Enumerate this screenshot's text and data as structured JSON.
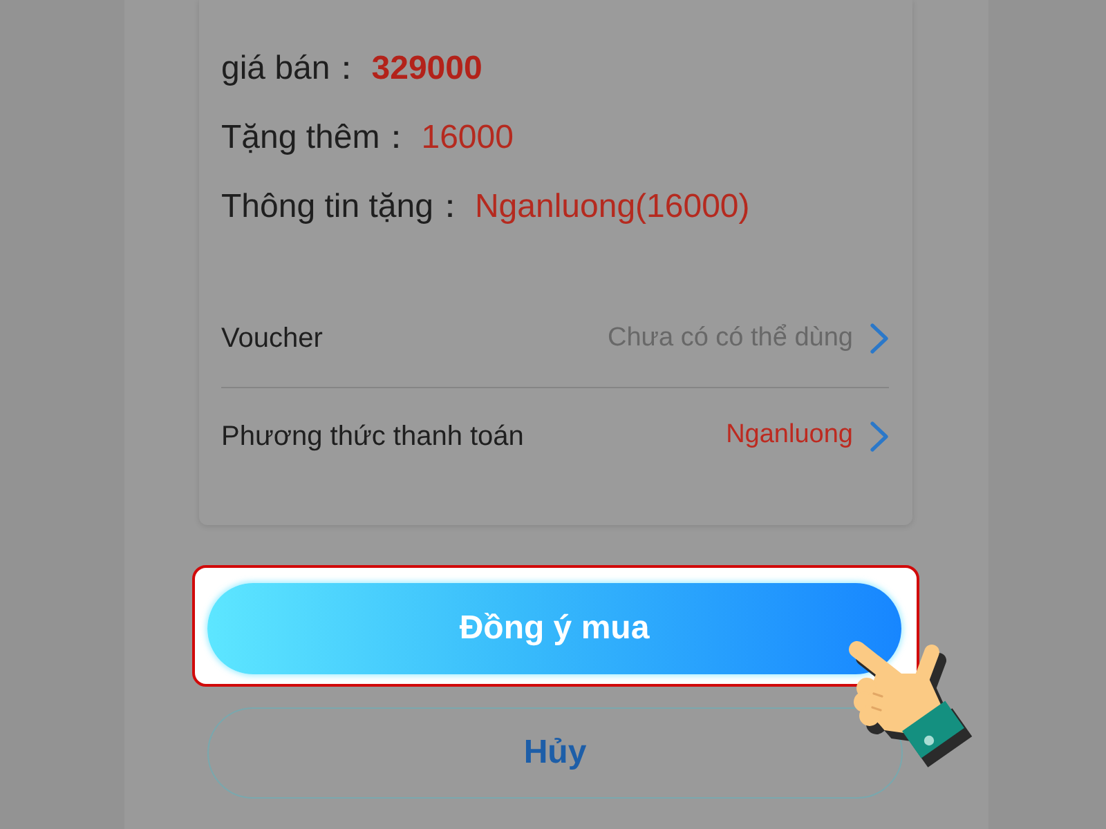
{
  "details": [
    {
      "label": "giá bán：",
      "value": "329000",
      "kind": "price"
    },
    {
      "label": "Tặng thêm：",
      "value": "16000",
      "kind": "gift"
    },
    {
      "label": "Thông tin tặng：",
      "value": "Nganluong(16000)",
      "kind": "gift"
    }
  ],
  "options": [
    {
      "label": "Voucher",
      "value": "Chưa có có thể dùng",
      "kind": "muted"
    },
    {
      "label": "Phương thức thanh toán",
      "value": "Nganluong",
      "kind": "accent"
    }
  ],
  "buttons": [
    {
      "label": "Đồng ý mua",
      "kind": "primary",
      "highlighted": true
    },
    {
      "label": "Hủy",
      "kind": "outline",
      "highlighted": false
    }
  ]
}
